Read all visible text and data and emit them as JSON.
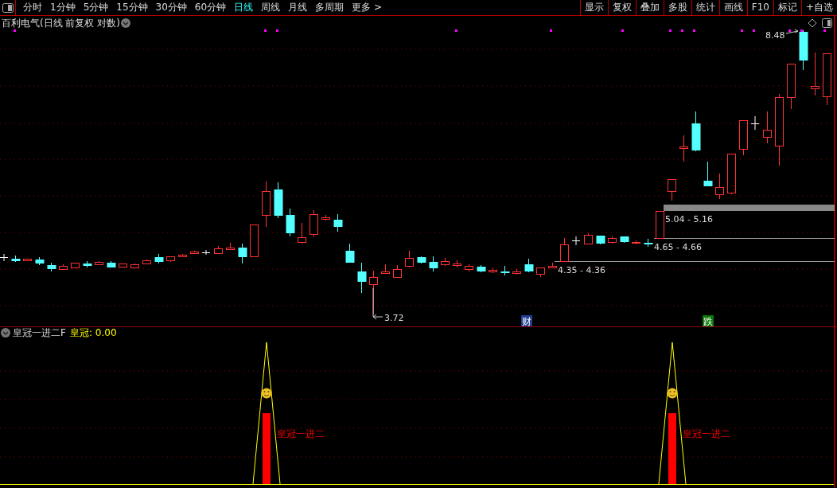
{
  "toolbar": {
    "periods": [
      {
        "label": "分时",
        "selected": false
      },
      {
        "label": "1分钟",
        "selected": false
      },
      {
        "label": "5分钟",
        "selected": false
      },
      {
        "label": "15分钟",
        "selected": false
      },
      {
        "label": "30分钟",
        "selected": false
      },
      {
        "label": "60分钟",
        "selected": false
      },
      {
        "label": "日线",
        "selected": true
      },
      {
        "label": "周线",
        "selected": false
      },
      {
        "label": "月线",
        "selected": false
      },
      {
        "label": "多周期",
        "selected": false
      },
      {
        "label": "更多 >",
        "selected": false
      }
    ],
    "buttons": [
      "显示",
      "复权",
      "叠加",
      "多股",
      "统计",
      "画线",
      "F10",
      "标记",
      "+自选"
    ]
  },
  "main_chart": {
    "title": "百利电气(日线 前复权 对数)",
    "price_labels": [
      "8.48",
      "5.04 - 5.16",
      "4.65 - 4.66",
      "4.35 - 4.36",
      "3.72"
    ],
    "event_marks": [
      {
        "text": "财",
        "color": "#1f3f8f"
      },
      {
        "text": "跌",
        "color": "#0a7a0a"
      }
    ]
  },
  "indicator": {
    "name": "皇冠一进二F",
    "series_label": "皇冠:",
    "value": "0.00",
    "signal_labels": [
      "皇冠一进二",
      "皇冠一进二"
    ]
  }
}
